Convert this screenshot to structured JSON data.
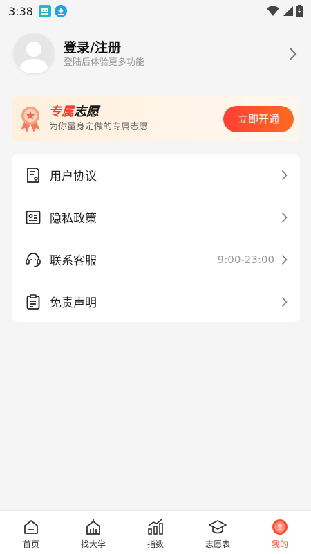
{
  "status_bar": {
    "time": "3:38",
    "icons": [
      "app-notification-icon",
      "download-icon",
      "wifi-icon",
      "signal-icon",
      "battery-icon"
    ]
  },
  "profile": {
    "title": "登录/注册",
    "subtitle": "登陆后体验更多功能"
  },
  "vip": {
    "title_red": "专属",
    "title_dark": "志愿",
    "subtitle": "为你量身定做的专属志愿",
    "button_label": "立即开通",
    "accent_color": "#ff3b30"
  },
  "menu": {
    "items": [
      {
        "label": "用户协议",
        "icon": "document-icon"
      },
      {
        "label": "隐私政策",
        "icon": "id-card-icon"
      },
      {
        "label": "联系客服",
        "icon": "headset-icon",
        "extra": "9:00-23:00"
      },
      {
        "label": "免责声明",
        "icon": "clipboard-icon"
      }
    ]
  },
  "bottom_nav": {
    "items": [
      {
        "label": "首页",
        "icon": "home-icon",
        "active": false
      },
      {
        "label": "找大学",
        "icon": "university-icon",
        "active": false
      },
      {
        "label": "指数",
        "icon": "chart-icon",
        "active": false
      },
      {
        "label": "志愿表",
        "icon": "graduation-cap-icon",
        "active": false
      },
      {
        "label": "我的",
        "icon": "profile-icon",
        "active": true
      }
    ],
    "active_color": "#ff4a2a"
  }
}
